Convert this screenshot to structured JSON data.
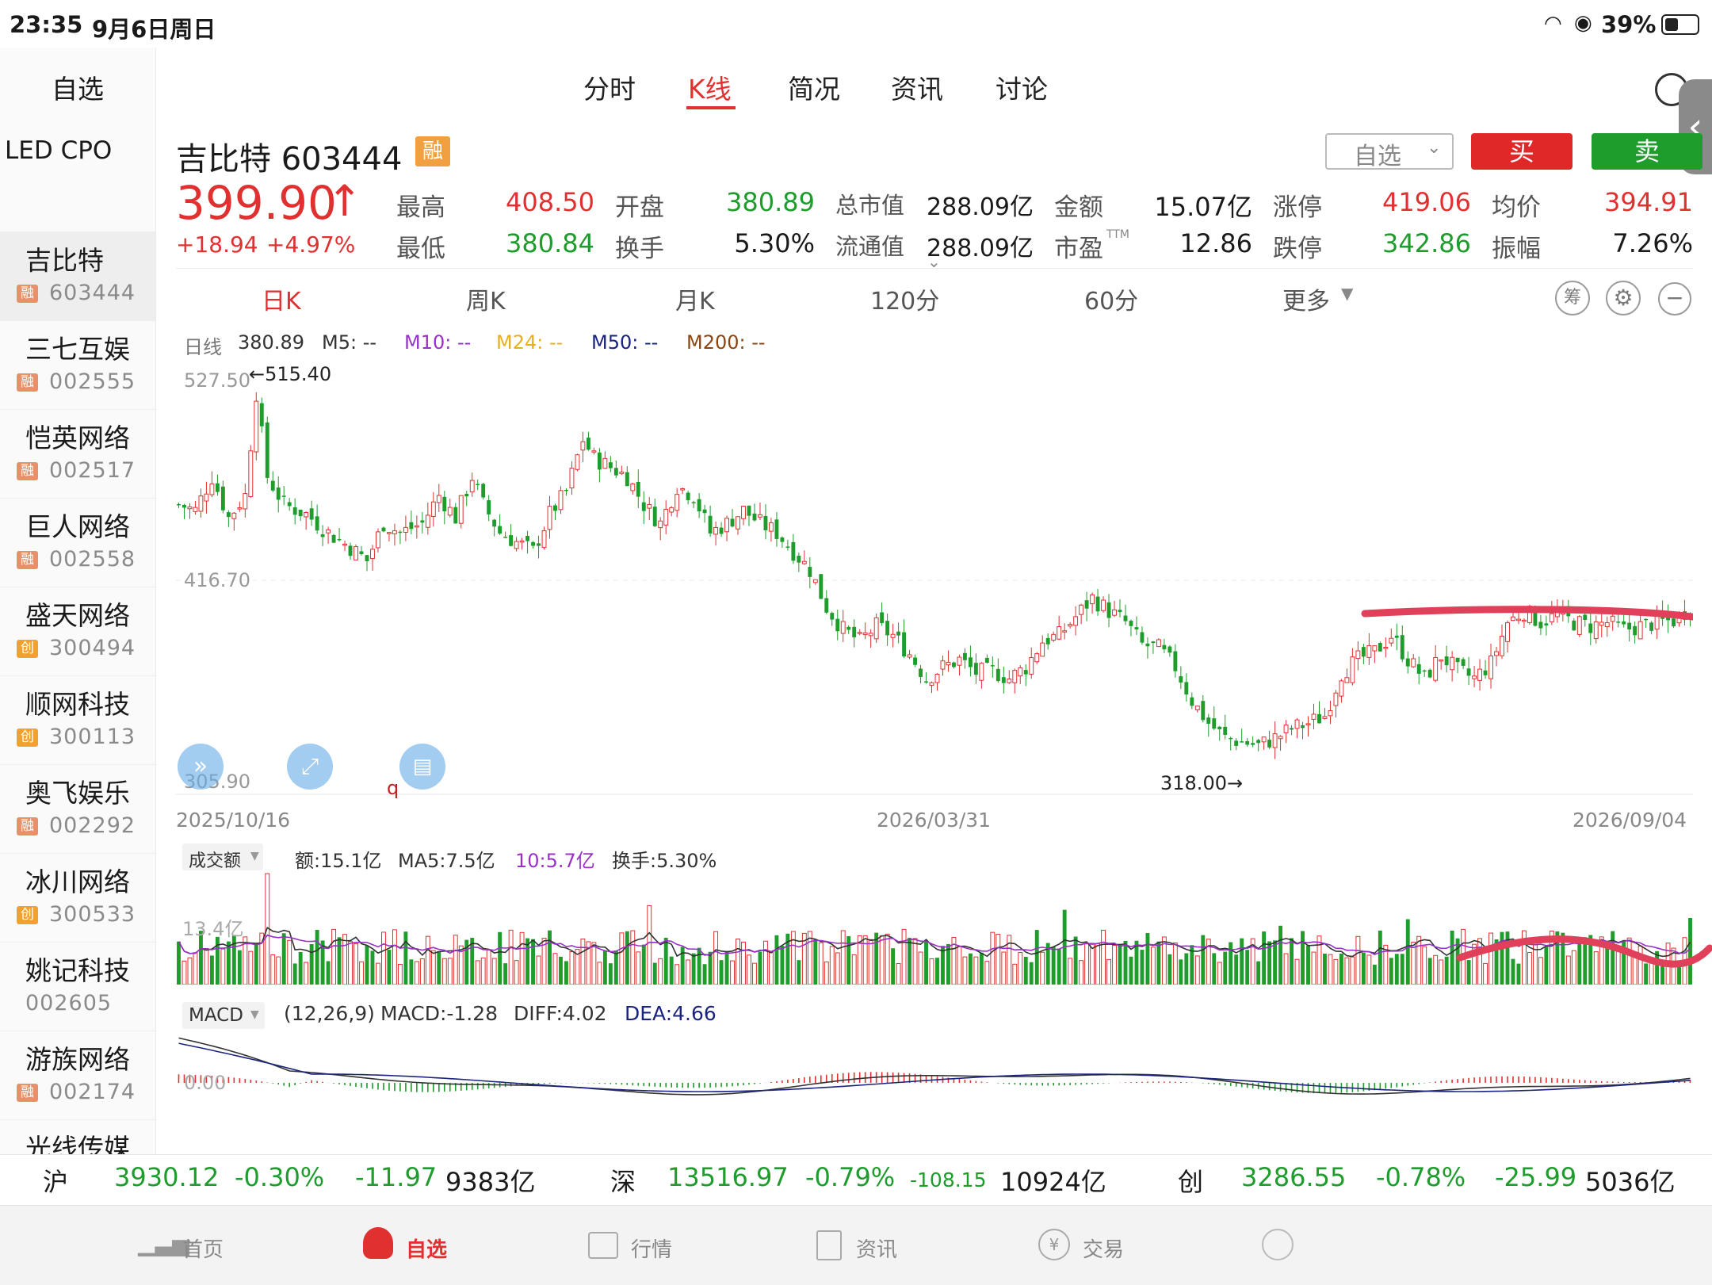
{
  "status": {
    "time": "23:35",
    "date": "9月6日周日",
    "battery": "39%"
  },
  "sidebar": {
    "title": "自选",
    "group": "LED CPO",
    "items": [
      {
        "name": "吉比特",
        "badge": "融",
        "code": "603444",
        "active": true
      },
      {
        "name": "三七互娱",
        "badge": "融",
        "code": "002555"
      },
      {
        "name": "恺英网络",
        "badge": "融",
        "code": "002517"
      },
      {
        "name": "巨人网络",
        "badge": "融",
        "code": "002558"
      },
      {
        "name": "盛天网络",
        "badge": "创",
        "code": "300494"
      },
      {
        "name": "顺网科技",
        "badge": "创",
        "code": "300113"
      },
      {
        "name": "奥飞娱乐",
        "badge": "融",
        "code": "002292"
      },
      {
        "name": "冰川网络",
        "badge": "创",
        "code": "300533"
      },
      {
        "name": "姚记科技",
        "badge": "",
        "code": "002605"
      },
      {
        "name": "游族网络",
        "badge": "融",
        "code": "002174"
      },
      {
        "name": "光线传媒",
        "badge": "",
        "code": ""
      }
    ]
  },
  "tabs": {
    "t1": "分时",
    "t2": "K线",
    "t3": "简况",
    "t4": "资讯",
    "t5": "讨论"
  },
  "stock": {
    "name": "吉比特 603444",
    "margin_badge": "融",
    "price": "399.90",
    "arrow": "↑",
    "change": "+18.94",
    "change_pct": "+4.97%",
    "watch_label": "自选",
    "buy": "买",
    "sell": "卖",
    "stats": {
      "high_l": "最高",
      "high_v": "408.50",
      "low_l": "最低",
      "low_v": "380.84",
      "open_l": "开盘",
      "open_v": "380.89",
      "turn_l": "换手",
      "turn_v": "5.30%",
      "mcap_l": "总市值",
      "mcap_v": "288.09亿",
      "fcap_l": "流通值",
      "fcap_v": "288.09亿",
      "amt_l": "金额",
      "amt_v": "15.07亿",
      "pe_l": "市盈",
      "pe_sup": "TTM",
      "pe_v": "12.86",
      "lu_l": "涨停",
      "lu_v": "419.06",
      "ld_l": "跌停",
      "ld_v": "342.86",
      "avg_l": "均价",
      "avg_v": "394.91",
      "amp_l": "振幅",
      "amp_v": "7.26%"
    }
  },
  "periods": {
    "p1": "日K",
    "p2": "周K",
    "p3": "月K",
    "p4": "120分",
    "p5": "60分",
    "p6": "更多"
  },
  "tool_icons": [
    "chip-icon",
    "gear-icon",
    "zoom-out-icon"
  ],
  "chip_label": "筹",
  "legend": {
    "day": "日线",
    "close": "380.89",
    "m5": "M5: --",
    "m10": "M10: --",
    "m24": "M24: --",
    "m50": "M50: --",
    "m200": "M200: --"
  },
  "colors": {
    "up": "#e03030",
    "down": "#1e9c2c",
    "m10": "#9b30c8",
    "m24": "#e6b020",
    "m50": "#1a237e",
    "m200": "#8b4513"
  },
  "kline_labels": {
    "y_top": "527.50",
    "y_mid": "416.70",
    "y_bot": "305.90",
    "max_mark": "←515.40",
    "min_mark": "318.00→",
    "q1": "q",
    "q2": "q",
    "x_start": "2025/10/16",
    "x_mid": "2026/03/31",
    "x_end": "2026/09/04"
  },
  "volume": {
    "selector": "成交额",
    "amount": "额:15.1亿",
    "ma5": "MA5:7.5亿",
    "ma10": "10:5.7亿",
    "turnover": "换手:5.30%",
    "y_top": "13.4亿"
  },
  "macd": {
    "selector": "MACD",
    "params": "(12,26,9)",
    "macd": "MACD:-1.28",
    "diff": "DIFF:4.02",
    "dea": "DEA:4.66",
    "y_mid": "0.00"
  },
  "indexbar": {
    "sh": {
      "name": "沪",
      "price": "3930.12",
      "pct": "-0.30%",
      "chg": "-11.97",
      "amt": "9383亿"
    },
    "sz": {
      "name": "深",
      "price": "13516.97",
      "pct": "-0.79%",
      "chg": "-108.15",
      "amt": "10924亿"
    },
    "cy": {
      "name": "创",
      "price": "3286.55",
      "pct": "-0.78%",
      "chg": "-25.99",
      "amt": "5036亿"
    }
  },
  "nav": {
    "home": "首页",
    "watch": "自选",
    "market": "行情",
    "news": "资讯",
    "trade": "交易"
  },
  "chart_data": [
    {
      "type": "candlestick",
      "title": "日线",
      "x_range": [
        "2025/10/16",
        "2026/09/04"
      ],
      "ylim": [
        305.9,
        527.5
      ],
      "y_ticks": [
        527.5,
        416.7,
        305.9
      ],
      "max": 515.4,
      "min": 318.0,
      "last": {
        "open": 380.89,
        "high": 408.5,
        "low": 380.84,
        "close": 399.9
      },
      "trend_path": [
        [
          0,
          455
        ],
        [
          3,
          452
        ],
        [
          6,
          470
        ],
        [
          9,
          448
        ],
        [
          12,
          460
        ],
        [
          14,
          515
        ],
        [
          16,
          470
        ],
        [
          19,
          455
        ],
        [
          23,
          450
        ],
        [
          27,
          440
        ],
        [
          31,
          432
        ],
        [
          34,
          425
        ],
        [
          37,
          445
        ],
        [
          40,
          440
        ],
        [
          44,
          445
        ],
        [
          47,
          460
        ],
        [
          50,
          448
        ],
        [
          53,
          470
        ],
        [
          55,
          455
        ],
        [
          58,
          440
        ],
        [
          61,
          435
        ],
        [
          64,
          430
        ],
        [
          67,
          450
        ],
        [
          70,
          462
        ],
        [
          73,
          490
        ],
        [
          75,
          480
        ],
        [
          78,
          475
        ],
        [
          81,
          470
        ],
        [
          84,
          455
        ],
        [
          87,
          445
        ],
        [
          90,
          465
        ],
        [
          93,
          460
        ],
        [
          96,
          440
        ],
        [
          99,
          445
        ],
        [
          102,
          452
        ],
        [
          105,
          445
        ],
        [
          108,
          440
        ],
        [
          111,
          430
        ],
        [
          114,
          420
        ],
        [
          117,
          400
        ],
        [
          120,
          388
        ],
        [
          123,
          382
        ],
        [
          126,
          390
        ],
        [
          129,
          385
        ],
        [
          132,
          375
        ],
        [
          135,
          362
        ],
        [
          138,
          368
        ],
        [
          141,
          372
        ],
        [
          144,
          365
        ],
        [
          147,
          366
        ],
        [
          150,
          362
        ],
        [
          153,
          368
        ],
        [
          156,
          382
        ],
        [
          159,
          385
        ],
        [
          162,
          395
        ],
        [
          165,
          405
        ],
        [
          168,
          398
        ],
        [
          171,
          392
        ],
        [
          174,
          380
        ],
        [
          177,
          378
        ],
        [
          180,
          368
        ],
        [
          183,
          350
        ],
        [
          186,
          338
        ],
        [
          189,
          330
        ],
        [
          192,
          328
        ],
        [
          195,
          326
        ],
        [
          198,
          330
        ],
        [
          201,
          335
        ],
        [
          204,
          338
        ],
        [
          207,
          342
        ],
        [
          210,
          365
        ],
        [
          213,
          372
        ],
        [
          216,
          376
        ],
        [
          219,
          385
        ],
        [
          222,
          372
        ],
        [
          225,
          362
        ],
        [
          228,
          374
        ],
        [
          231,
          366
        ],
        [
          234,
          362
        ],
        [
          237,
          370
        ],
        [
          240,
          392
        ],
        [
          243,
          398
        ],
        [
          246,
          392
        ],
        [
          249,
          396
        ],
        [
          252,
          392
        ],
        [
          255,
          390
        ],
        [
          258,
          392
        ],
        [
          261,
          388
        ],
        [
          264,
          390
        ],
        [
          267,
          392
        ],
        [
          270,
          393
        ],
        [
          273,
          400
        ]
      ]
    },
    {
      "type": "bar",
      "title": "成交额",
      "ylim": [
        0,
        13.4
      ],
      "latest": 15.1,
      "ma5": 7.5,
      "ma10": 5.7
    },
    {
      "type": "line",
      "title": "MACD",
      "params": "(12,26,9)",
      "macd": -1.28,
      "diff": 4.02,
      "dea": 4.66
    }
  ]
}
